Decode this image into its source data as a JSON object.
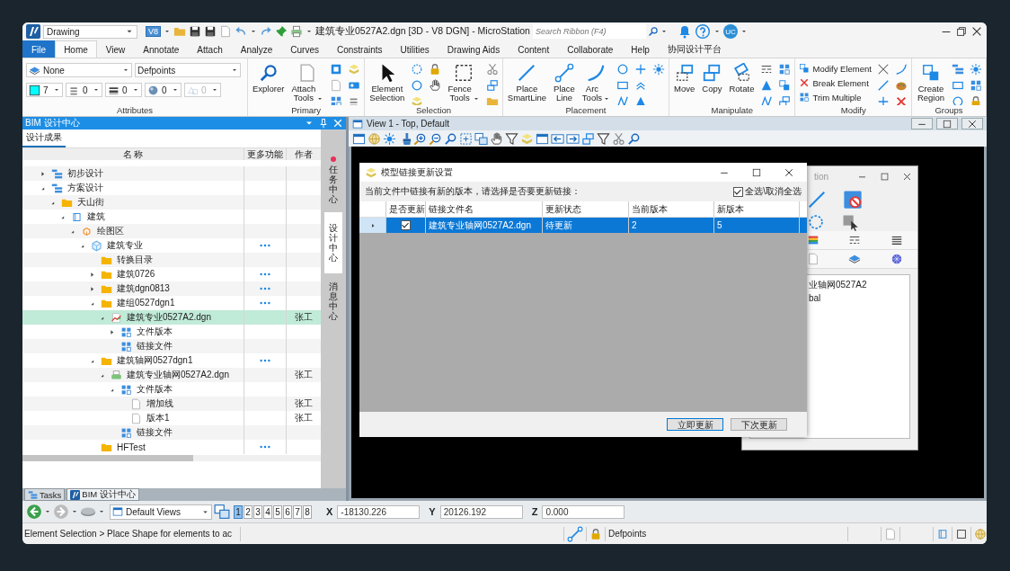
{
  "title_bar": {
    "workspace": "Drawing",
    "badge": "V8",
    "title": "建筑专业0527A2.dgn [3D - V8 DGN] - MicroStation",
    "search": {
      "placeholder": "Search Ribbon (F4)"
    },
    "user": "UC"
  },
  "ribbon_tabs": [
    {
      "label": "File",
      "kind": "file",
      "selected": false
    },
    {
      "label": "Home",
      "kind": "tab",
      "selected": true
    },
    {
      "label": "View",
      "kind": "tab",
      "selected": false
    },
    {
      "label": "Annotate",
      "kind": "tab",
      "selected": false
    },
    {
      "label": "Attach",
      "kind": "tab",
      "selected": false
    },
    {
      "label": "Analyze",
      "kind": "tab",
      "selected": false
    },
    {
      "label": "Curves",
      "kind": "tab",
      "selected": false
    },
    {
      "label": "Constraints",
      "kind": "tab",
      "selected": false
    },
    {
      "label": "Utilities",
      "kind": "tab",
      "selected": false
    },
    {
      "label": "Drawing Aids",
      "kind": "tab",
      "selected": false
    },
    {
      "label": "Content",
      "kind": "tab",
      "selected": false
    },
    {
      "label": "Collaborate",
      "kind": "tab",
      "selected": false
    },
    {
      "label": "Help",
      "kind": "tab",
      "selected": false
    },
    {
      "label": "协同设计平台",
      "kind": "tab",
      "selected": false
    }
  ],
  "ribbon_groups": [
    {
      "kind": "attributes",
      "title": "Attributes",
      "fields": [
        {
          "kind": "level",
          "value": "None",
          "disabled": false
        },
        {
          "kind": "level",
          "value": "Defpoints",
          "disabled": false
        },
        {
          "kind": "symbology",
          "value": "7",
          "disabled": false
        },
        {
          "kind": "symbology",
          "value": "0",
          "disabled": false
        },
        {
          "kind": "symbology",
          "value": "0",
          "disabled": false
        },
        {
          "kind": "symbology",
          "value": "0",
          "disabled": false
        },
        {
          "kind": "symbology",
          "value": "0",
          "disabled": true
        }
      ]
    },
    {
      "kind": "primary",
      "title": "Primary",
      "buttons": [
        {
          "label": "Explorer",
          "menu": false
        },
        {
          "label": "Attach Tools",
          "menu": true
        }
      ]
    },
    {
      "kind": "selection",
      "title": "Selection",
      "buttons": [
        {
          "label": "Element Selection",
          "menu": false
        },
        {
          "label": "Fence Tools",
          "menu": true
        }
      ]
    },
    {
      "kind": "placement",
      "title": "Placement",
      "buttons": [
        {
          "label": "Place SmartLine",
          "menu": false
        },
        {
          "label": "Place Line",
          "menu": false
        },
        {
          "label": "Arc Tools",
          "menu": true
        }
      ]
    },
    {
      "kind": "manipulate",
      "title": "Manipulate",
      "buttons": [
        {
          "label": "Move",
          "menu": false
        },
        {
          "label": "Copy",
          "menu": false
        },
        {
          "label": "Rotate",
          "menu": false
        }
      ]
    },
    {
      "kind": "modify",
      "title": "Modify",
      "commands": [
        "Modify Element",
        "Break Element",
        "Trim Multiple"
      ]
    },
    {
      "kind": "groups",
      "title": "Groups",
      "buttons": [
        {
          "label": "Create Region",
          "menu": false
        }
      ]
    }
  ],
  "panel": {
    "title": "BIM 设计中心",
    "tabs": [
      {
        "label": "设计成果",
        "selected": true
      }
    ],
    "columns": [
      "名 称",
      "更多功能",
      "作者"
    ],
    "rows": [
      {
        "name": "初步设计",
        "kind": "stage",
        "expanded": false,
        "selected": false
      },
      {
        "name": "方案设计",
        "kind": "stage",
        "expanded": true,
        "selected": false,
        "children": [
          {
            "name": "天山街",
            "kind": "folder",
            "expanded": true,
            "selected": false,
            "children": [
              {
                "name": "建筑",
                "kind": "book",
                "expanded": true,
                "selected": false,
                "children": [
                  {
                    "name": "绘图区",
                    "kind": "area",
                    "expanded": true,
                    "selected": false,
                    "children": [
                      {
                        "name": "建筑专业",
                        "kind": "model",
                        "expanded": true,
                        "more": true,
                        "selected": false,
                        "children": [
                          {
                            "name": "转换目录",
                            "kind": "folder",
                            "selected": false
                          },
                          {
                            "name": "建筑0726",
                            "kind": "folder",
                            "expanded": false,
                            "more": true,
                            "selected": false
                          },
                          {
                            "name": "建筑dgn0813",
                            "kind": "folder",
                            "expanded": false,
                            "more": true,
                            "selected": false
                          },
                          {
                            "name": "建组0527dgn1",
                            "kind": "folder",
                            "expanded": true,
                            "more": true,
                            "selected": false,
                            "children": [
                              {
                                "name": "建筑专业0527A2.dgn",
                                "kind": "chart",
                                "expanded": true,
                                "author": "张工",
                                "selected": true,
                                "children": [
                                  {
                                    "name": "文件版本",
                                    "kind": "set",
                                    "expanded": false,
                                    "selected": false
                                  },
                                  {
                                    "name": "链接文件",
                                    "kind": "set",
                                    "selected": false
                                  }
                                ]
                              }
                            ]
                          },
                          {
                            "name": "建筑轴网0527dgn1",
                            "kind": "folder",
                            "expanded": true,
                            "more": true,
                            "selected": false,
                            "children": [
                              {
                                "name": "建筑专业轴网0527A2.dgn",
                                "kind": "printer",
                                "expanded": true,
                                "author": "张工",
                                "selected": false,
                                "children": [
                                  {
                                    "name": "文件版本",
                                    "kind": "set",
                                    "expanded": true,
                                    "selected": false,
                                    "children": [
                                      {
                                        "name": "增加线",
                                        "kind": "file",
                                        "author": "张工",
                                        "selected": false
                                      },
                                      {
                                        "name": "版本1",
                                        "kind": "file",
                                        "author": "张工",
                                        "selected": false
                                      }
                                    ]
                                  },
                                  {
                                    "name": "链接文件",
                                    "kind": "set",
                                    "selected": false
                                  }
                                ]
                              }
                            ]
                          },
                          {
                            "name": "HFTest",
                            "kind": "folder",
                            "more": true,
                            "selected": false
                          }
                        ]
                      }
                    ]
                  }
                ]
              }
            ]
          }
        ]
      }
    ],
    "side_tabs": [
      {
        "label": "任务中心",
        "alert": true,
        "selected": false
      },
      {
        "label": "设计中心",
        "alert": false,
        "selected": true
      },
      {
        "label": "消息中心",
        "alert": false,
        "selected": false
      }
    ],
    "bottom_tabs": [
      {
        "label": "Tasks",
        "kind": "tasks",
        "selected": false
      },
      {
        "label": "BIM 设计中心",
        "kind": "bim",
        "selected": true
      }
    ]
  },
  "view": {
    "title": "View 1 - Top, Default"
  },
  "dialog": {
    "title": "模型链接更新设置",
    "message": "当前文件中链接有新的版本，请选择是否要更新链接：",
    "select_all": {
      "label": "全选\\取消全选",
      "checked": true
    },
    "columns": [
      "是否更新",
      "链接文件名",
      "更新状态",
      "当前版本",
      "新版本"
    ],
    "rows": [
      {
        "update": true,
        "file": "建筑专业轴网0527A2.dgn",
        "status": "待更新",
        "current": "2",
        "new": "5",
        "selected": true
      }
    ],
    "buttons": [
      "立即更新",
      "下次更新"
    ]
  },
  "behind_window": {
    "title": "tion",
    "lines": [
      "业轴网0527A2",
      "bal"
    ]
  },
  "view_bar": {
    "view_set": "Default Views",
    "views": [
      {
        "label": "1",
        "selected": true
      },
      {
        "label": "2",
        "selected": false
      },
      {
        "label": "3",
        "selected": false
      },
      {
        "label": "4",
        "selected": false
      },
      {
        "label": "5",
        "selected": false
      },
      {
        "label": "6",
        "selected": false
      },
      {
        "label": "7",
        "selected": false
      },
      {
        "label": "8",
        "selected": false
      }
    ],
    "coords": [
      {
        "axis": "X",
        "value": "-18130.226"
      },
      {
        "axis": "Y",
        "value": "20126.192"
      },
      {
        "axis": "Z",
        "value": "0.000"
      }
    ]
  },
  "status_bar": {
    "prompt": "Element Selection > Place Shape for elements to ac",
    "level": "Defpoints"
  }
}
